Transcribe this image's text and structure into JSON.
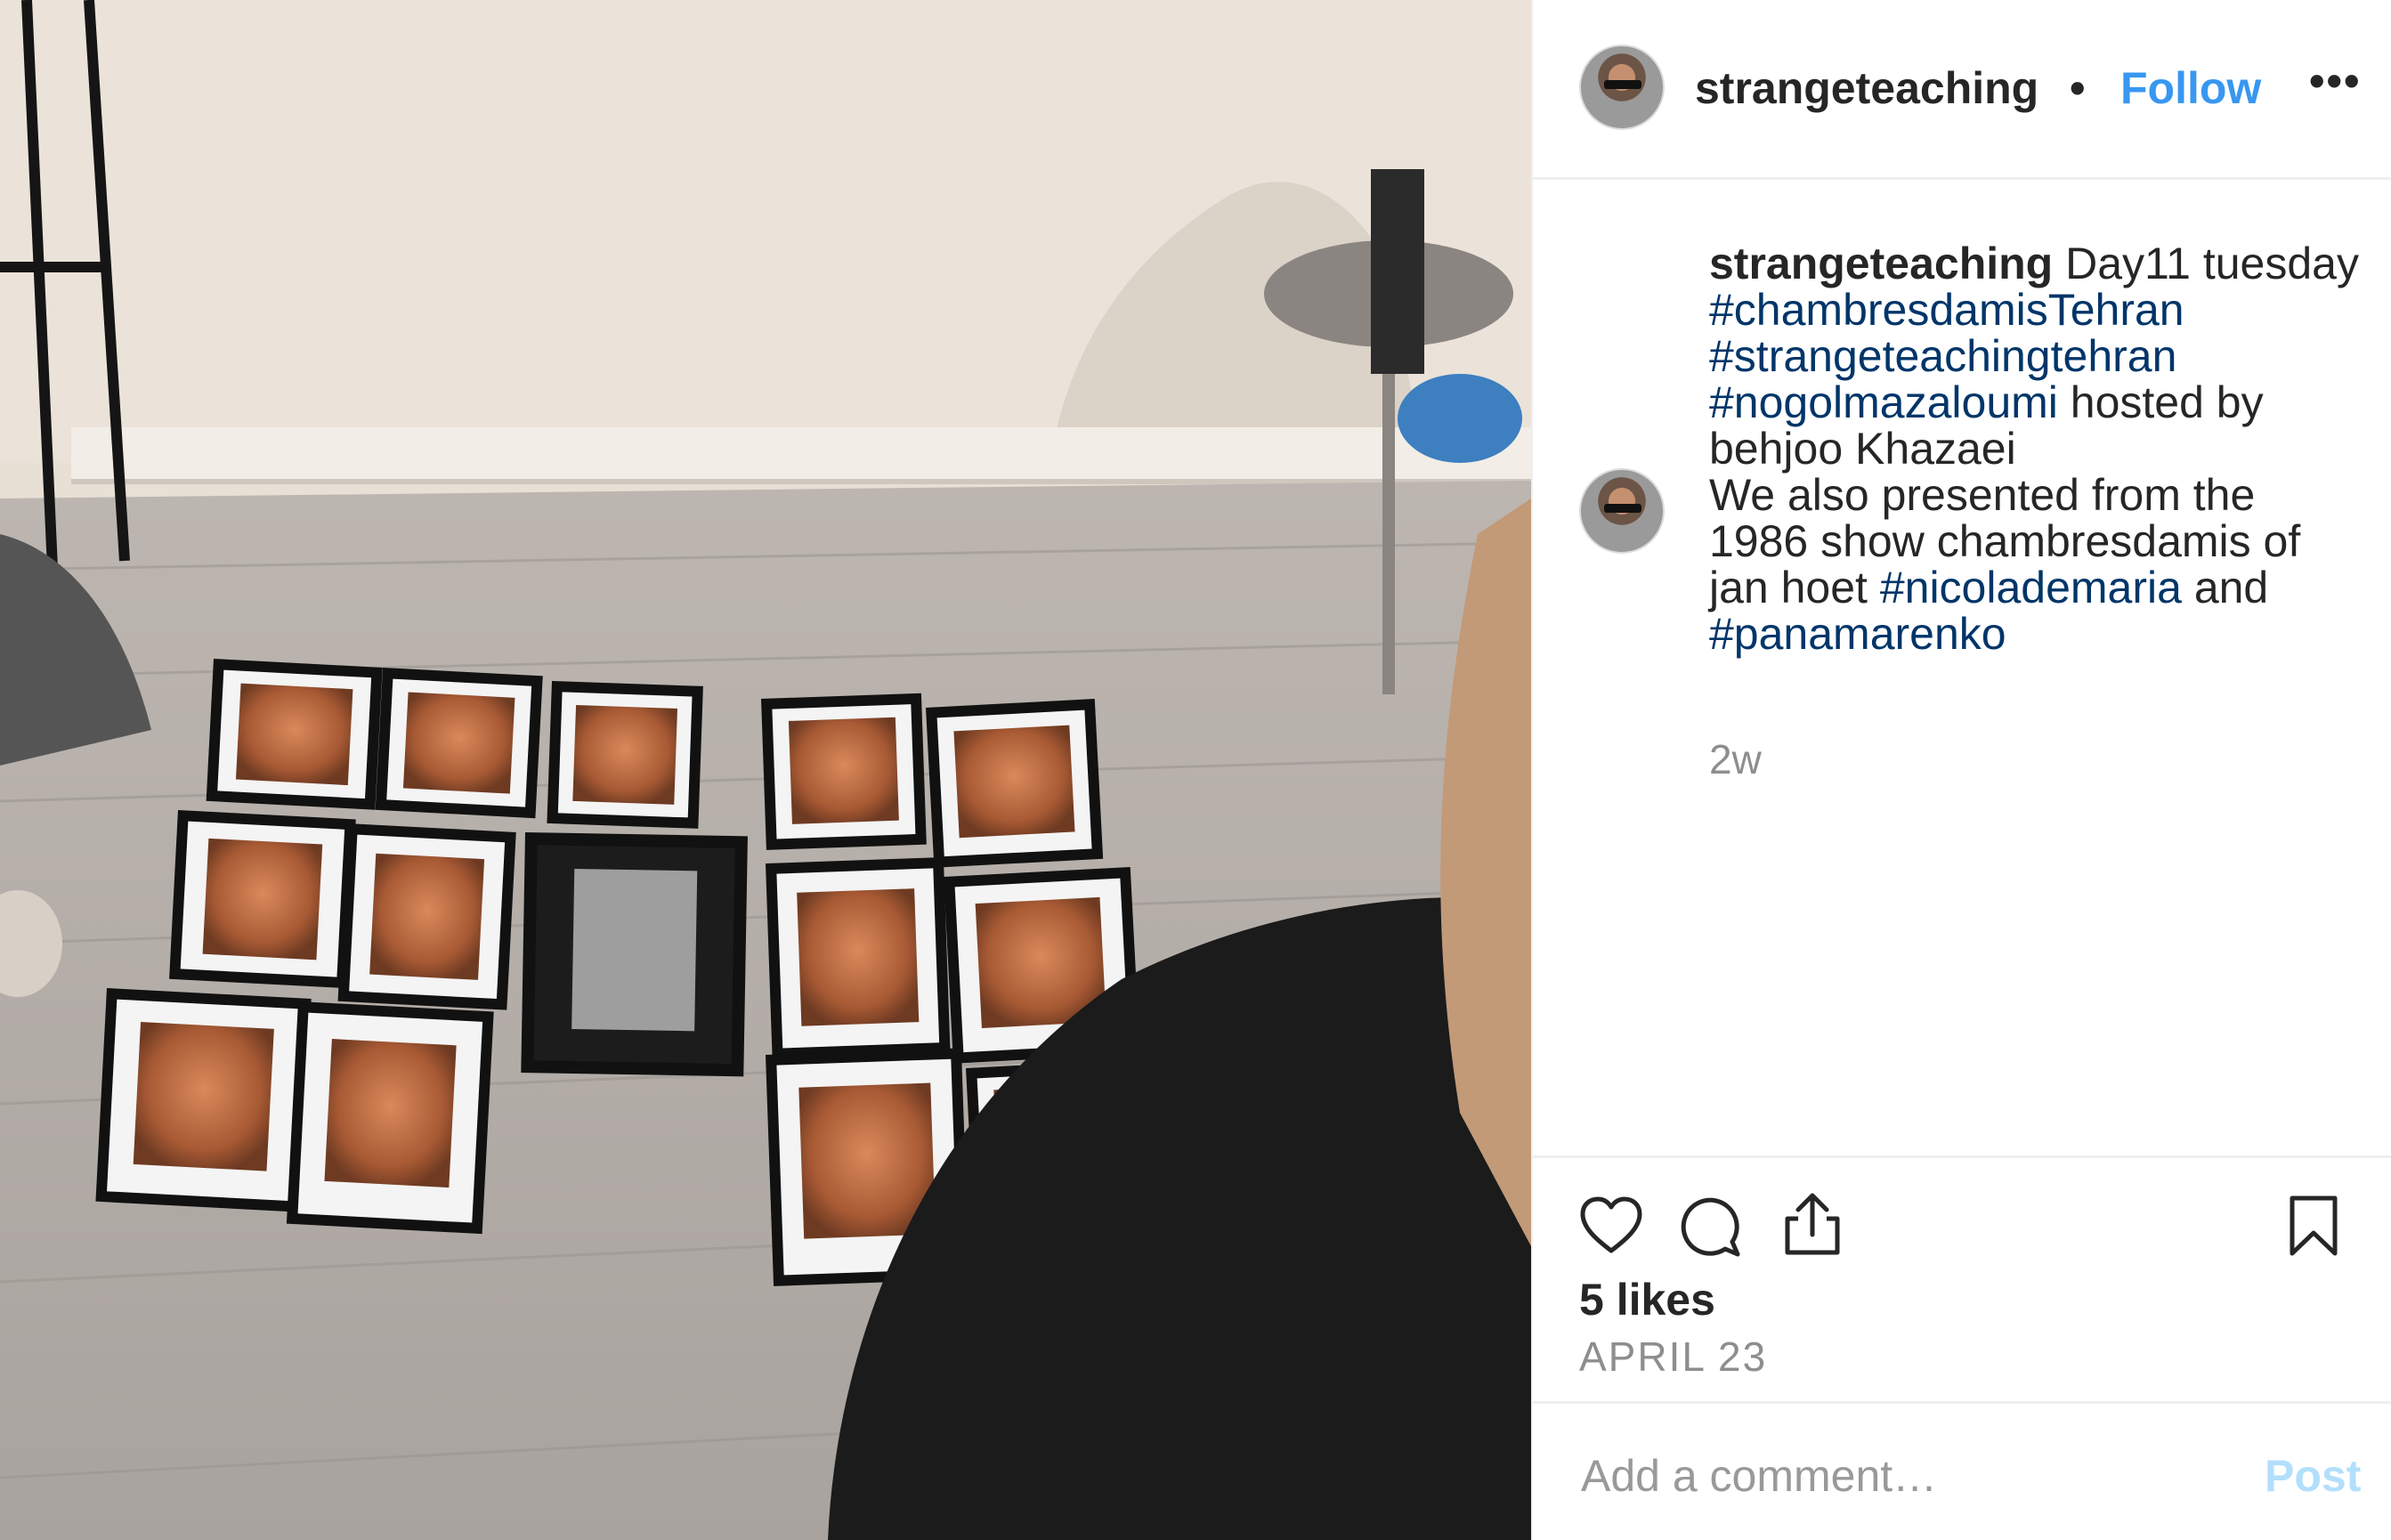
{
  "header": {
    "username": "strangeteaching",
    "separator": "•",
    "follow_label": "Follow",
    "more_label": "•••"
  },
  "caption": {
    "username": "strangeteaching",
    "text_1": " Day11 tuesday ",
    "tag_1": "#chambresdamisTehran",
    "tag_2": "#strangeteachingtehran",
    "tag_3": "#nogolmazaloumi",
    "text_2": " hosted by behjoo Khazaei",
    "text_3": "We also presented from the 1986 show chambresdamis of jan hoet ",
    "tag_4": "#nicolademaria",
    "text_4": " and ",
    "tag_5": "#panamarenko",
    "time": "2w"
  },
  "actions": {
    "like_icon": "heart-icon",
    "comment_icon": "comment-icon",
    "share_icon": "share-icon",
    "save_icon": "bookmark-icon",
    "likes": "5 likes",
    "date": "APRIL 23"
  },
  "comment": {
    "placeholder": "Add a comment…",
    "post_label": "Post"
  },
  "colors": {
    "link": "#3897f0",
    "hashtag": "#003569",
    "muted": "#8e8e8e",
    "post_disabled": "#b2dffc",
    "divider": "#efefef"
  }
}
